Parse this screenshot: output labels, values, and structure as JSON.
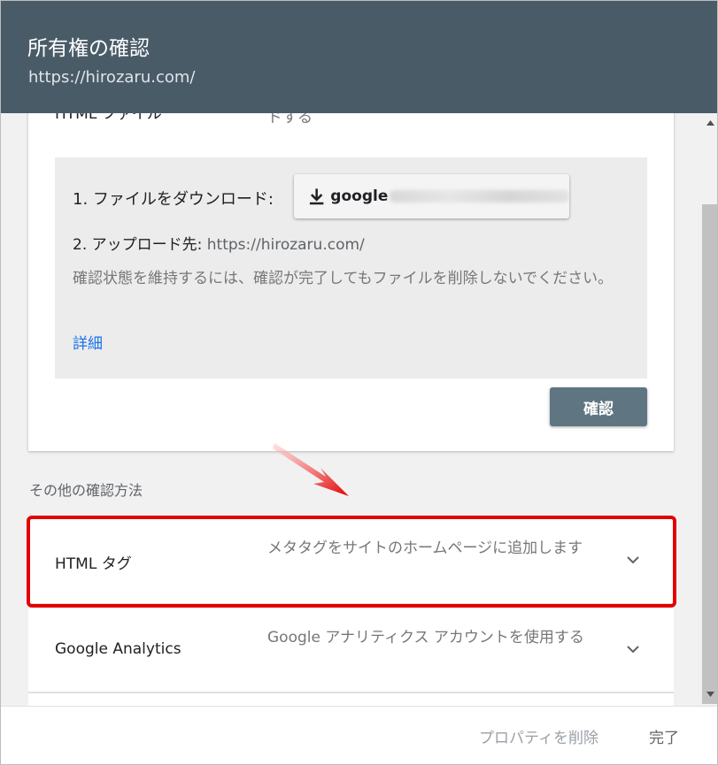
{
  "dialog": {
    "title": "所有権の確認",
    "url": "https://hirozaru.com/"
  },
  "html_file": {
    "label": "HTML ファイル",
    "description": "ドする",
    "step1_label": "1. ファイルをダウンロード:",
    "download_label": "google",
    "step2_label": "2. アップロード先:",
    "step2_url": "https://hirozaru.com/",
    "note": "確認状態を維持するには、確認が完了してもファイルを削除しないでください。",
    "details_link": "詳細",
    "confirm_label": "確認"
  },
  "other_methods": {
    "title": "その他の確認方法",
    "items": [
      {
        "label": "HTML タグ",
        "description": "メタタグをサイトのホームページに追加します"
      },
      {
        "label": "Google Analytics",
        "description": "Google アナリティクス アカウントを使用する"
      }
    ]
  },
  "footer": {
    "delete_label": "プロパティを削除",
    "done_label": "完了"
  },
  "colors": {
    "header_bg": "#4a5b68",
    "confirm_bg": "#5f7582",
    "highlight": "#e30000",
    "link": "#1a73e8"
  }
}
